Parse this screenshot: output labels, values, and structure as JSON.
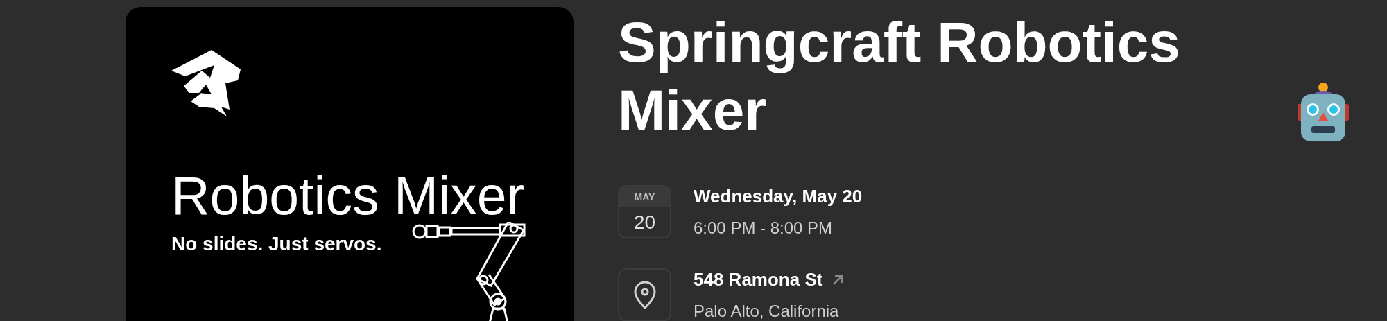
{
  "cover": {
    "title": "Robotics Mixer",
    "tagline": "No slides. Just servos."
  },
  "event": {
    "title": "Springcraft Robotics Mixer"
  },
  "date": {
    "month": "MAY",
    "day": "20",
    "weekday_date": "Wednesday, May 20",
    "time": "6:00 PM - 8:00 PM"
  },
  "location": {
    "street": "548 Ramona St",
    "city": "Palo Alto, California"
  }
}
